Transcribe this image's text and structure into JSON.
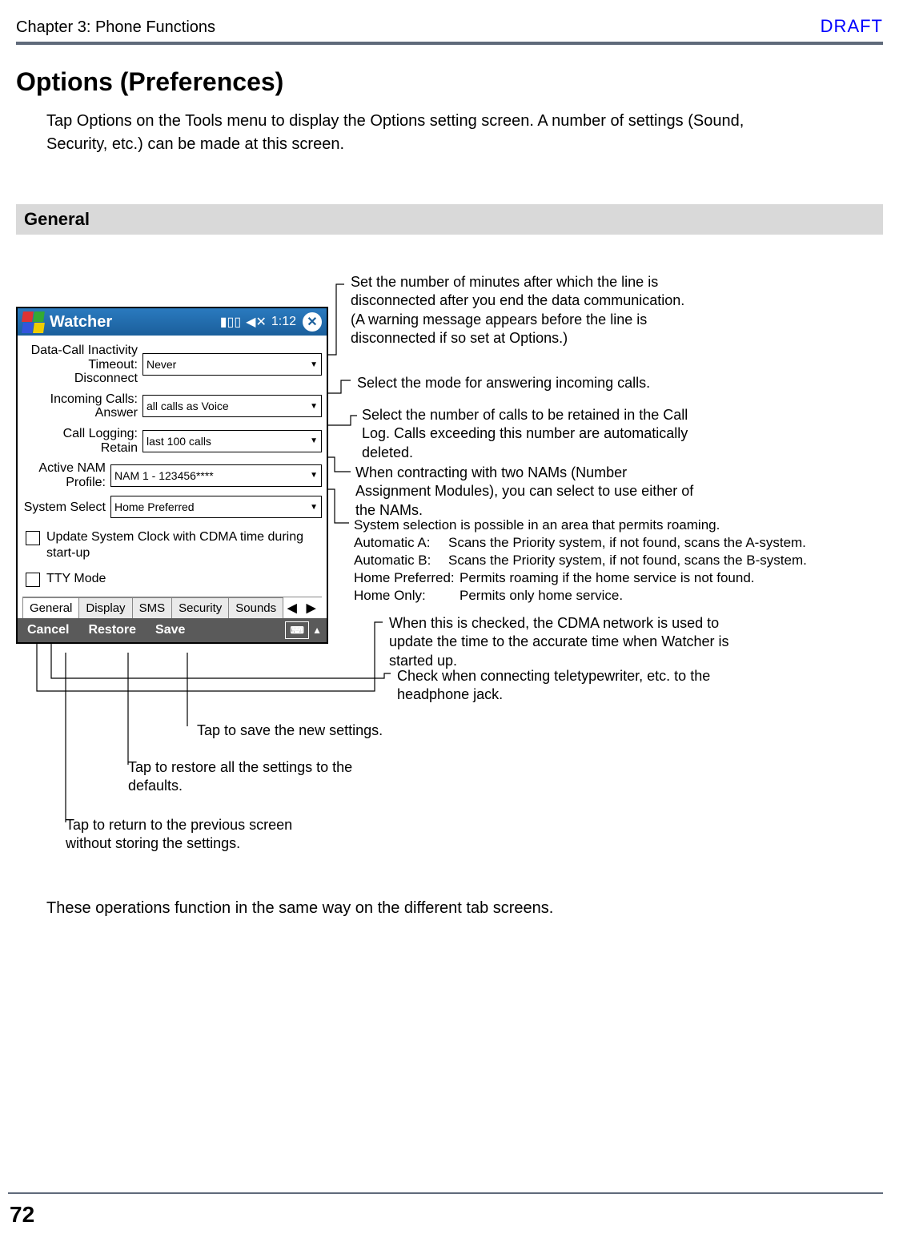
{
  "header": {
    "chapter": "Chapter 3: Phone Functions",
    "draft": "DRAFT"
  },
  "title": "Options (Preferences)",
  "intro": "Tap Options on the Tools menu to display the Options setting screen. A number of settings (Sound, Security, etc.) can be made at this screen.",
  "section": "General",
  "device": {
    "app_title": "Watcher",
    "clock": "1:12",
    "fields": {
      "data_call_label": "Data-Call Inactivity Timeout: Disconnect",
      "data_call_value": "Never",
      "incoming_label": "Incoming Calls: Answer",
      "incoming_value": "all calls as Voice",
      "logging_label": "Call Logging: Retain",
      "logging_value": "last 100 calls",
      "nam_label": "Active NAM Profile:",
      "nam_value": "NAM 1 - 123456****",
      "system_label": "System Select",
      "system_value": "Home Preferred",
      "clock_sync": "Update System Clock with CDMA time during start-up",
      "tty": "TTY Mode"
    },
    "tabs": [
      "General",
      "Display",
      "SMS",
      "Security",
      "Sounds"
    ],
    "buttons": {
      "cancel": "Cancel",
      "restore": "Restore",
      "save": "Save"
    }
  },
  "callouts": {
    "timeout": "Set the number of minutes after which the line is disconnected after you end the data communication.\n(A warning message appears before the line is disconnected if so set at Options.)",
    "answer": "Select the mode for answering incoming calls.",
    "logging": "Select the number of calls to be retained in the Call Log.  Calls exceeding this number are automatically deleted.",
    "nam": "When contracting with two NAMs (Number Assignment Modules), you can select to use either of the NAMs.",
    "system_head": "System selection is possible in an area that permits roaming.",
    "system_a_k": "Automatic A:",
    "system_a_v": "Scans the Priority system, if not found, scans the A-system.",
    "system_b_k": "Automatic B:",
    "system_b_v": "Scans the Priority system, if not found, scans the B-system.",
    "system_hp_k": "Home Preferred:",
    "system_hp_v": "Permits roaming if the home service is not found.",
    "system_ho_k": "Home Only:",
    "system_ho_v": "Permits only home service.",
    "clock_sync": "When this is checked, the CDMA network is used to update the time to the accurate time when Watcher is started up.",
    "tty": "Check when connecting teletypewriter, etc. to the headphone jack.",
    "save_hint": "Tap to save the new settings.",
    "restore_hint": "Tap to restore all the settings to the defaults.",
    "cancel_hint": "Tap to return to the previous screen without storing the settings."
  },
  "closing": "These operations function in the same way on the different tab screens.",
  "page_number": "72"
}
